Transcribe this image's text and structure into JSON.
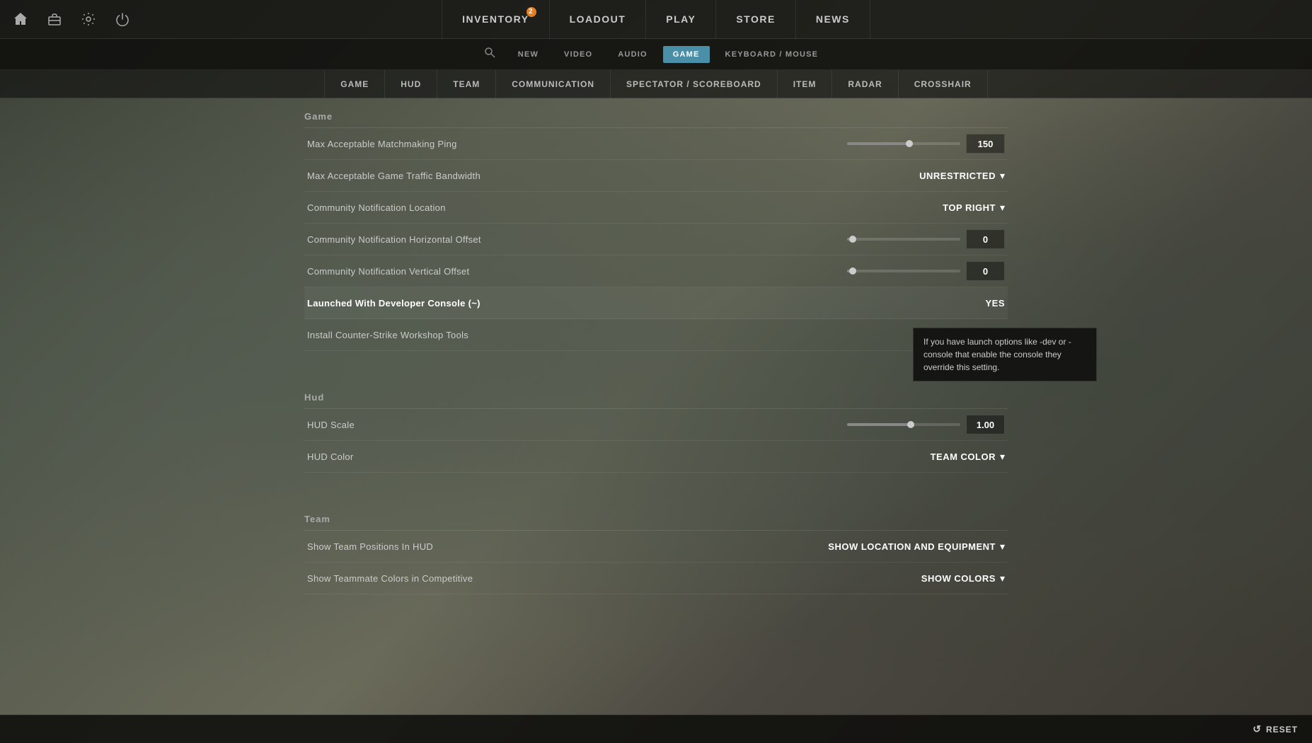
{
  "nav": {
    "items": [
      {
        "label": "INVENTORY",
        "badge": null
      },
      {
        "label": "LOADOUT",
        "badge": null
      },
      {
        "label": "PLAY",
        "badge": null
      },
      {
        "label": "STORE",
        "badge": null
      },
      {
        "label": "NEWS",
        "badge": null
      }
    ],
    "inventory_badge": "2"
  },
  "settings_tabs": {
    "items": [
      {
        "label": "NEW"
      },
      {
        "label": "VIDEO"
      },
      {
        "label": "AUDIO"
      },
      {
        "label": "GAME",
        "active": true
      },
      {
        "label": "KEYBOARD / MOUSE"
      }
    ]
  },
  "sub_tabs": {
    "items": [
      {
        "label": "GAME"
      },
      {
        "label": "HUD"
      },
      {
        "label": "TEAM"
      },
      {
        "label": "COMMUNICATION"
      },
      {
        "label": "SPECTATOR / SCOREBOARD"
      },
      {
        "label": "ITEM"
      },
      {
        "label": "RADAR"
      },
      {
        "label": "CROSSHAIR"
      }
    ]
  },
  "sections": {
    "game": {
      "title": "Game",
      "settings": [
        {
          "label": "Max Acceptable Matchmaking Ping",
          "type": "slider",
          "value": "150",
          "fill_percent": 55
        },
        {
          "label": "Max Acceptable Game Traffic Bandwidth",
          "type": "dropdown",
          "value": "UNRESTRICTED"
        },
        {
          "label": "Community Notification Location",
          "type": "dropdown",
          "value": "TOP RIGHT"
        },
        {
          "label": "Community Notification Horizontal Offset",
          "type": "slider",
          "value": "0",
          "fill_percent": 5
        },
        {
          "label": "Community Notification Vertical Offset",
          "type": "slider",
          "value": "0",
          "fill_percent": 5
        },
        {
          "label": "Launched With Developer Console (~)",
          "type": "value",
          "value": "YES",
          "highlighted": true,
          "tooltip": "If you have launch options like -dev or -console that enable the console they override this setting."
        },
        {
          "label": "Install Counter-Strike Workshop Tools",
          "type": "button",
          "value": ""
        }
      ]
    },
    "hud": {
      "title": "Hud",
      "settings": [
        {
          "label": "HUD Scale",
          "type": "slider",
          "value": "1.00",
          "fill_percent": 56
        },
        {
          "label": "HUD Color",
          "type": "dropdown",
          "value": "TEAM COLOR"
        }
      ]
    },
    "team": {
      "title": "Team",
      "settings": [
        {
          "label": "Show Team Positions In HUD",
          "type": "dropdown",
          "value": "SHOW LOCATION AND EQUIPMENT"
        },
        {
          "label": "Show Teammate Colors in Competitive",
          "type": "dropdown",
          "value": "SHOW COLORS"
        }
      ]
    }
  },
  "tooltip": {
    "text": "If you have launch options like -dev or -console that enable the console they override this setting."
  },
  "bottom_bar": {
    "reset_label": "RESET"
  }
}
